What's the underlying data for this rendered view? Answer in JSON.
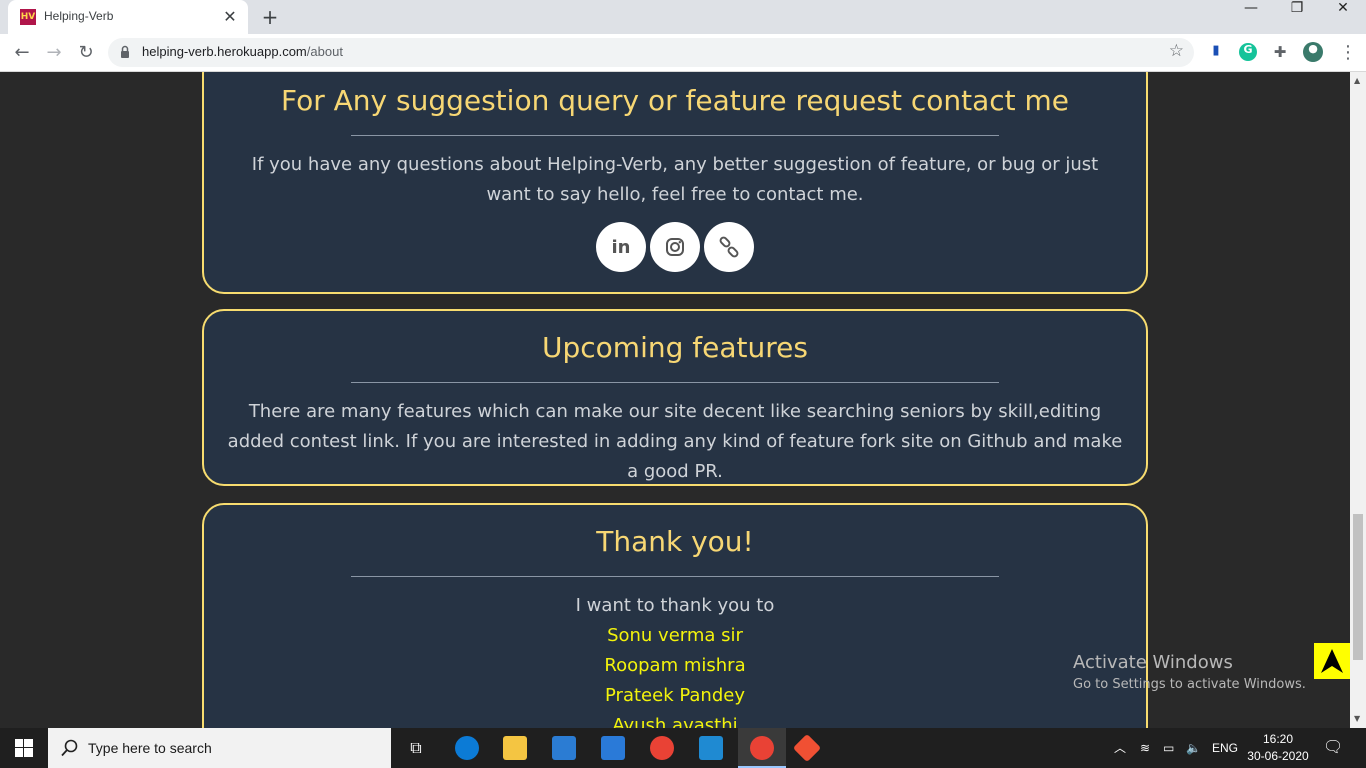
{
  "browser": {
    "tab_title": "Helping-Verb",
    "favicon_text": "HV",
    "tab_close": "✕",
    "new_tab": "+",
    "url_host": "helping-verb.herokuapp.com",
    "url_path": "/about",
    "window_controls": {
      "minimize": "—",
      "restore": "❐",
      "close": "✕"
    },
    "extension_icons": [
      "flag-icon",
      "grammarly-icon",
      "extensions-puzzle-icon",
      "profile-avatar-icon"
    ]
  },
  "contact_card": {
    "title": "For Any suggestion query or feature request contact me",
    "body": "If you have any questions about Helping-Verb, any better suggestion of feature, or bug or just want to say hello, feel free to contact me.",
    "social": [
      {
        "name": "linkedin-icon",
        "glyph": "in"
      },
      {
        "name": "instagram-icon",
        "glyph": ""
      },
      {
        "name": "link-icon",
        "glyph": ""
      }
    ]
  },
  "upcoming_card": {
    "title": "Upcoming features",
    "body": "There are many features which can make our site decent like searching seniors by skill,editing added contest link. If you are interested in adding any kind of feature fork site on Github and make a good PR."
  },
  "thanks_card": {
    "title": "Thank you!",
    "intro": "I want to thank you to",
    "names": [
      "Sonu verma sir",
      "Roopam mishra",
      "Prateek Pandey",
      "Ayush avasthi"
    ]
  },
  "watermark": {
    "line1": "Activate Windows",
    "line2": "Go to Settings to activate Windows."
  },
  "taskbar": {
    "search_placeholder": "Type here to search",
    "language": "ENG",
    "time": "16:20",
    "date": "30-06-2020",
    "colors": {
      "edge": "#0c7bd6",
      "explorer": "#f4c542",
      "store": "#2b7cd3",
      "mail": "#2a7ad8",
      "chrome": "#e94235",
      "vscode": "#1f8ad2",
      "git": "#f05033"
    }
  }
}
